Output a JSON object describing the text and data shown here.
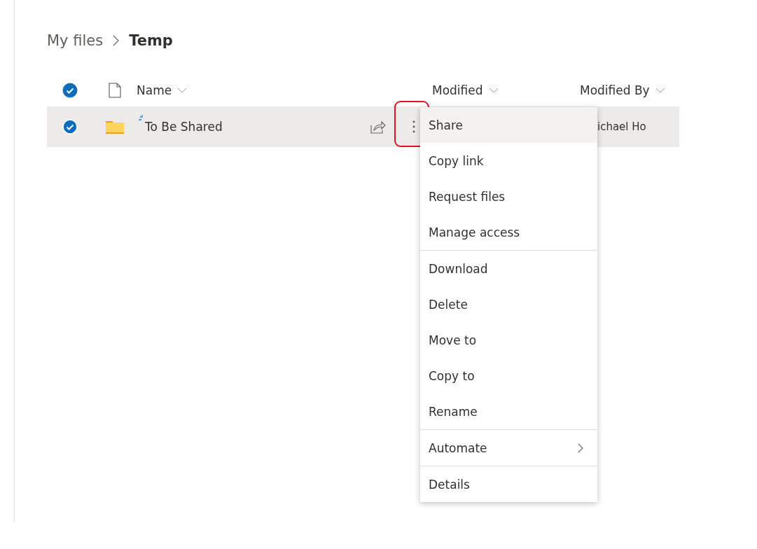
{
  "breadcrumb": [
    {
      "label": "My files",
      "current": false
    },
    {
      "label": "Temp",
      "current": true
    }
  ],
  "header": {
    "checked": true,
    "columns": [
      "Name",
      "Modified",
      "Modified By"
    ]
  },
  "rows": [
    {
      "name": "To Be Shared",
      "checked": true,
      "modified_by": "ichael Ho"
    }
  ],
  "context_menu": {
    "groups": [
      [
        {
          "label": "Share",
          "selected": true,
          "submenu": false
        },
        {
          "label": "Copy link",
          "selected": false,
          "submenu": false
        },
        {
          "label": "Request files",
          "selected": false,
          "submenu": false
        },
        {
          "label": "Manage access",
          "selected": false,
          "submenu": false
        }
      ],
      [
        {
          "label": "Download",
          "selected": false,
          "submenu": false
        },
        {
          "label": "Delete",
          "selected": false,
          "submenu": false
        },
        {
          "label": "Move to",
          "selected": false,
          "submenu": false
        },
        {
          "label": "Copy to",
          "selected": false,
          "submenu": false
        },
        {
          "label": "Rename",
          "selected": false,
          "submenu": false
        }
      ],
      [
        {
          "label": "Automate",
          "selected": false,
          "submenu": true
        }
      ],
      [
        {
          "label": "Details",
          "selected": false,
          "submenu": false
        }
      ]
    ]
  }
}
